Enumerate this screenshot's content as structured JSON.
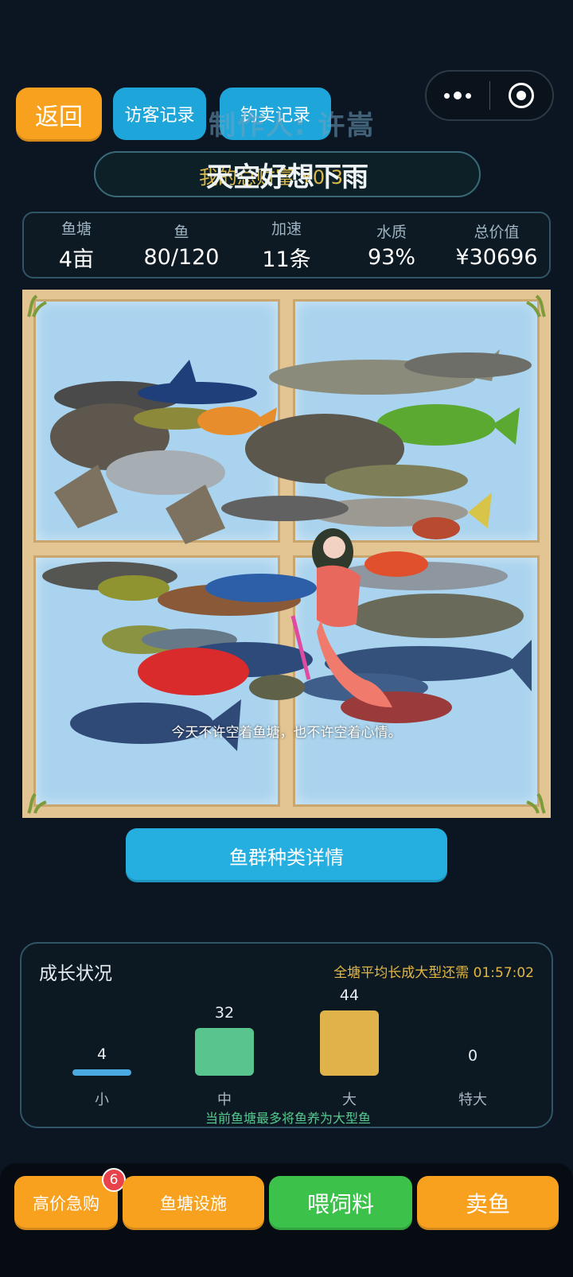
{
  "header": {
    "back_label": "返回",
    "visitor_label": "访客记录",
    "sale_label": "钓卖记录",
    "maker_text": "制作人: 许嵩",
    "pond_name": "天空好想下雨",
    "income_text": "我的总财富 ¥0.3"
  },
  "stats": [
    {
      "label": "鱼塘",
      "value": "4亩"
    },
    {
      "label": "鱼",
      "value": "80/120"
    },
    {
      "label": "加速",
      "value": "11条"
    },
    {
      "label": "水质",
      "value": "93%"
    },
    {
      "label": "总价值",
      "value": "¥30696"
    }
  ],
  "pond": {
    "caption": "今天不许空着鱼塘，也不许空着心情。"
  },
  "species_button": "鱼群种类详情",
  "growth": {
    "title": "成长状况",
    "timer_text": "全塘平均长成大型还需 01:57:02",
    "sizes": [
      {
        "name": "小",
        "count": "4"
      },
      {
        "name": "中",
        "count": "32"
      },
      {
        "name": "大",
        "count": "44"
      },
      {
        "name": "特大",
        "count": "0"
      }
    ],
    "note": "当前鱼塘最多将鱼养为大型鱼"
  },
  "bottom": {
    "buy_label": "高价急购",
    "buy_badge": "6",
    "facility_label": "鱼塘设施",
    "feed_label": "喂饲料",
    "sell_label": "卖鱼"
  },
  "colors": {
    "orange": "#f7a11f",
    "blue": "#1ea6db",
    "green": "#3cc24a",
    "bar_small": "#4aa9e0",
    "bar_medium": "#58c58f",
    "bar_large": "#e0b24a"
  }
}
